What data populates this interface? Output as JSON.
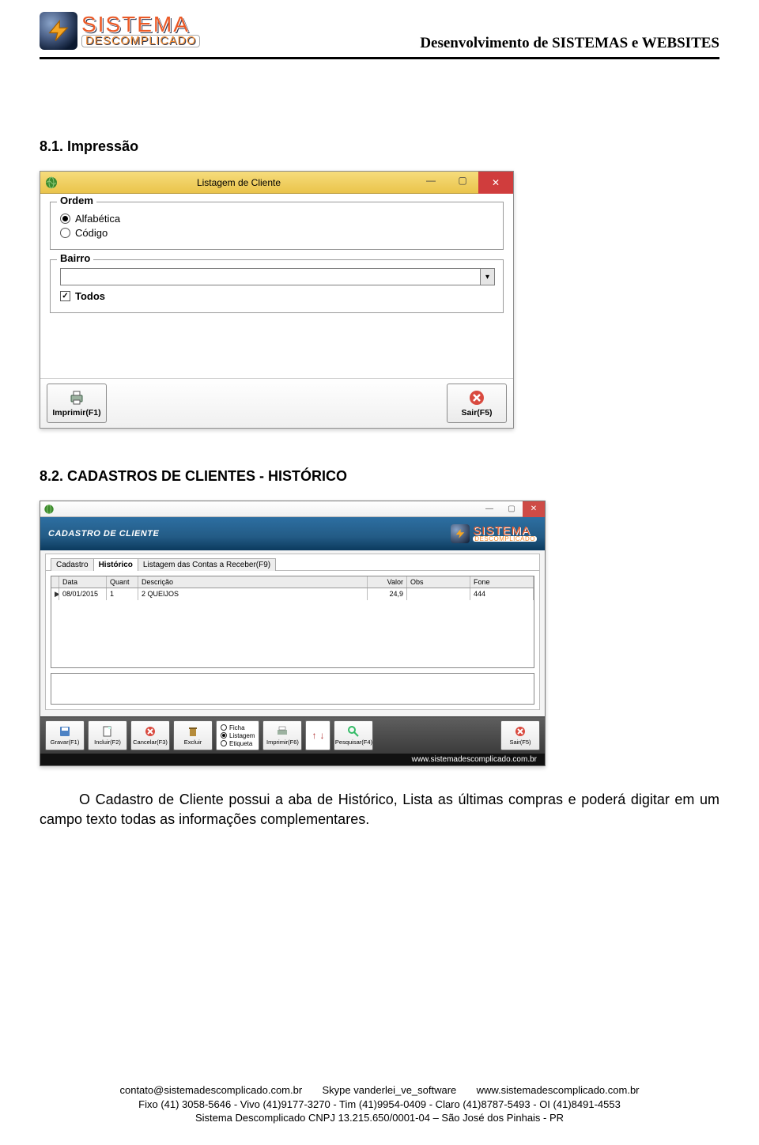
{
  "header": {
    "logo_top": "SISTEMA",
    "logo_bottom": "DESCOMPLICADO",
    "tagline": "Desenvolvimento de SISTEMAS e WEBSITES"
  },
  "section1": {
    "heading": "8.1. Impressão",
    "dialog_title": "Listagem de Cliente",
    "ordem_legend": "Ordem",
    "ordem_alfabetica": "Alfabética",
    "ordem_codigo": "Código",
    "bairro_legend": "Bairro",
    "bairro_value": "",
    "todos_label": "Todos",
    "btn_imprimir": "Imprimir(F1)",
    "btn_sair": "Sair(F5)"
  },
  "section2": {
    "heading": "8.2. CADASTROS DE CLIENTES - HISTÓRICO",
    "strip_title": "CADASTRO DE CLIENTE",
    "tabs": {
      "cadastro": "Cadastro",
      "historico": "Histórico",
      "listagem": "Listagem das Contas a Receber(F9)"
    },
    "grid": {
      "headers": {
        "data": "Data",
        "quant": "Quant",
        "desc": "Descrição",
        "valor": "Valor",
        "obs": "Obs",
        "fone": "Fone"
      },
      "row": {
        "data": "08/01/2015",
        "quant": "1",
        "desc": "2 QUEIJOS",
        "valor": "24,9",
        "obs": "",
        "fone": "444"
      }
    },
    "toolbar": {
      "gravar": "Gravar(F1)",
      "incluir": "Incluir(F2)",
      "cancelar": "Cancelar(F3)",
      "excluir": "Excluir",
      "opt_ficha": "Ficha",
      "opt_listagem": "Listagem",
      "opt_etiqueta": "Etiqueta",
      "imprimir": "Imprimir(F6)",
      "pesquisar": "Pesquisar(F4)",
      "sair": "Sair(F5)"
    },
    "url": "www.sistemadescomplicado.com.br"
  },
  "paragraph": "O Cadastro de Cliente possui a aba de Histórico, Lista as últimas compras e poderá digitar em um campo texto todas as informações complementares.",
  "footer": {
    "l1_a": "contato@sistemadescomplicado.com.br",
    "l1_b": "Skype vanderlei_ve_software",
    "l1_c": "www.sistemadescomplicado.com.br",
    "l2": "Fixo (41) 3058-5646 - Vivo (41)9177-3270 - Tim (41)9954-0409 - Claro (41)8787-5493 - OI (41)8491-4553",
    "l3": "Sistema Descomplicado CNPJ 13.215.650/0001-04 – São José dos Pinhais - PR"
  }
}
